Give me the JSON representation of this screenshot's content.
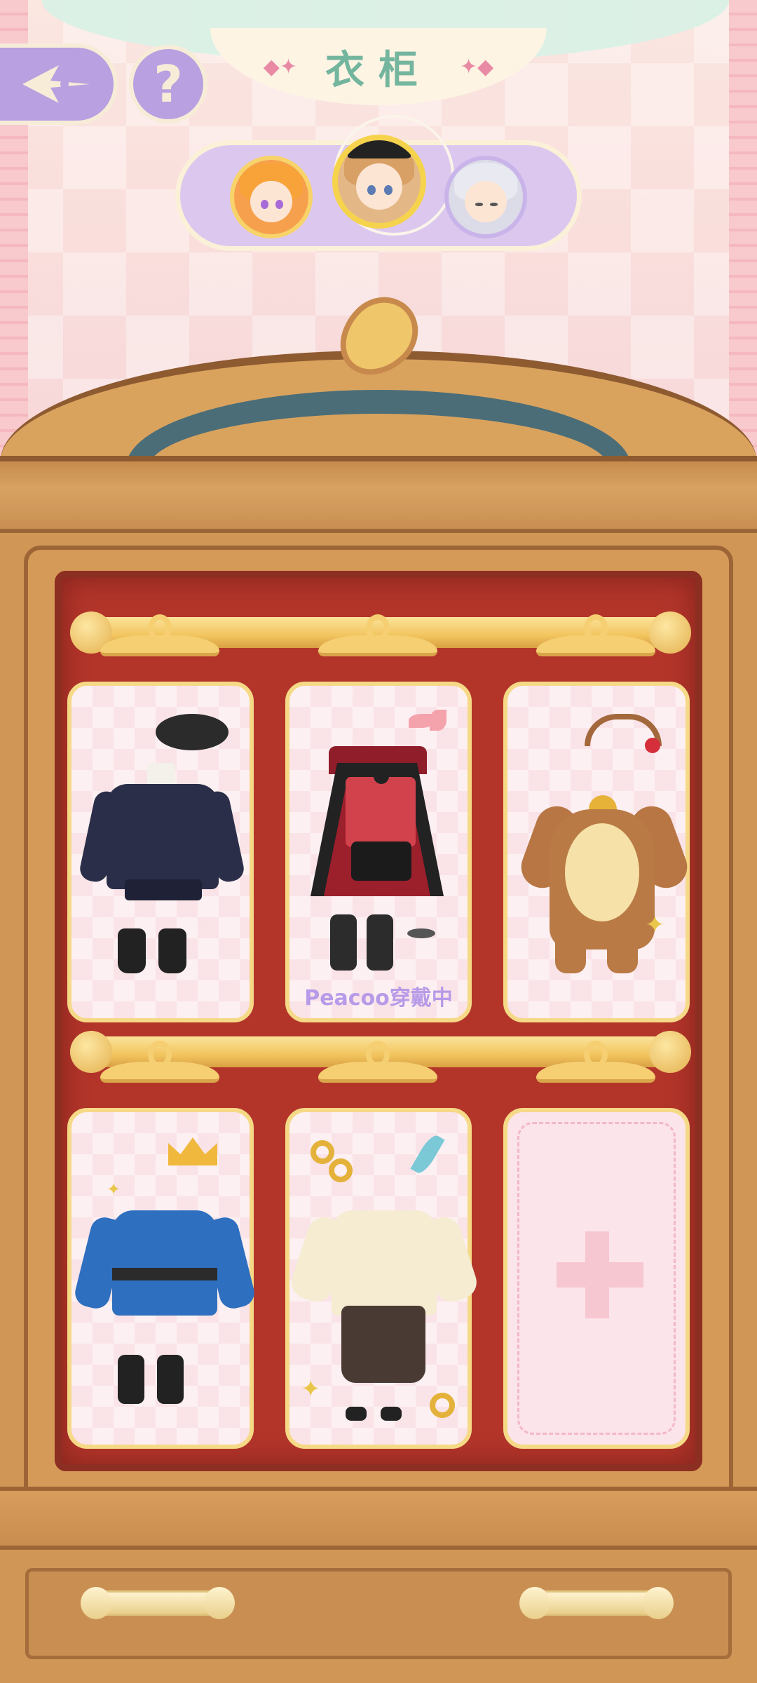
{
  "header": {
    "title": "衣柜",
    "back_icon": "back-arrow-icon",
    "help_label": "?"
  },
  "characters": [
    {
      "name": "avatar-orange-hair",
      "selected": false
    },
    {
      "name": "avatar-peacoo",
      "selected": true
    },
    {
      "name": "avatar-silver-hair",
      "selected": false
    }
  ],
  "wardrobe": {
    "slots": [
      {
        "outfit": "dark-uniform-beret",
        "status": ""
      },
      {
        "outfit": "vampire-cape-vest",
        "status": "Peacoo穿戴中"
      },
      {
        "outfit": "reindeer-onesie",
        "status": ""
      },
      {
        "outfit": "royal-blue-coat",
        "status": ""
      },
      {
        "outfit": "cream-chinese-jacket",
        "status": ""
      },
      {
        "outfit": "empty-add-slot",
        "status": ""
      }
    ]
  },
  "colors": {
    "accent_purple": "#b9a0e0",
    "title_green": "#74b59e",
    "wood": "#d59a58",
    "wardrobe_red": "#b3352a"
  }
}
